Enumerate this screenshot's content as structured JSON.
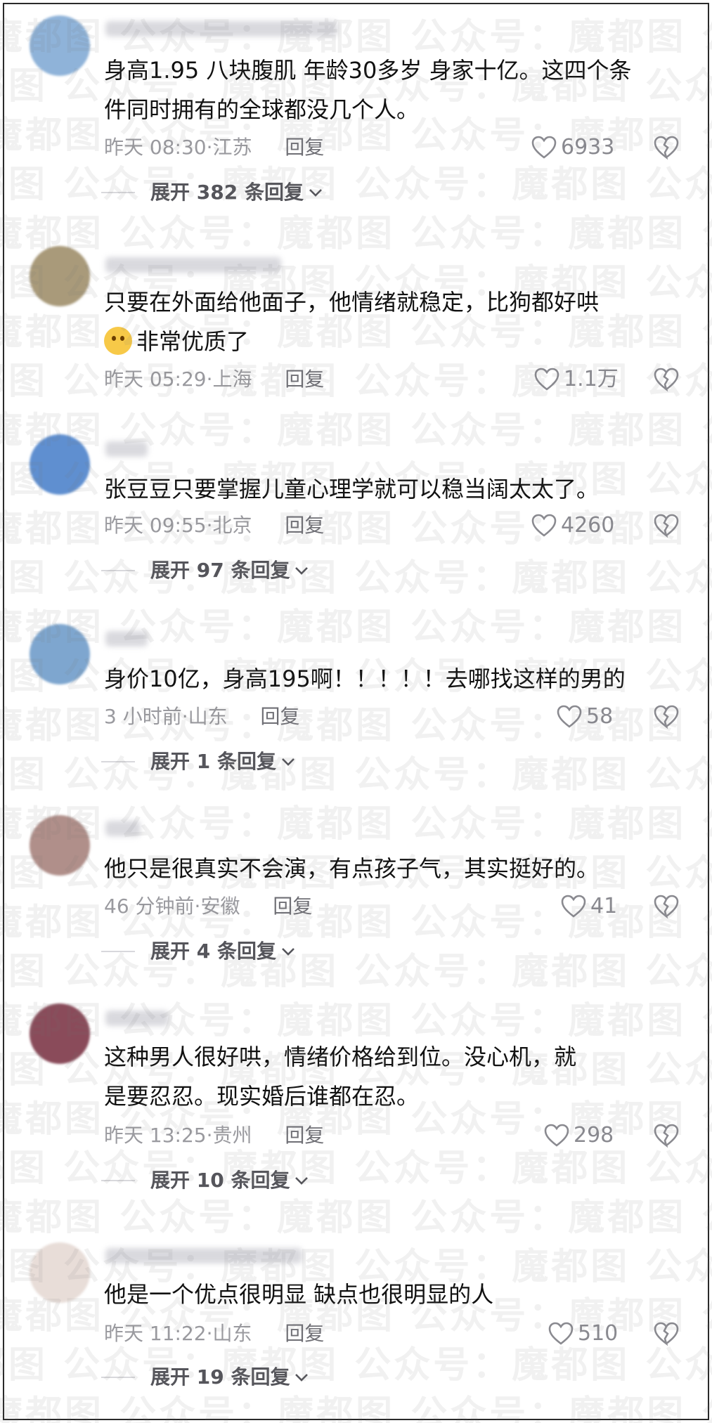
{
  "watermark_text": "魔都图 公众号：魔都图 公众号：魔都图 公众号：魔都图 公众号：",
  "comments": [
    {
      "text_lines": [
        "身高1.95 八块腹肌 年龄30多岁 身家十亿。这四个条",
        "件同时拥有的全球都没几个人。"
      ],
      "time": "昨天 08:30",
      "location": "江苏",
      "reply_label": "回复",
      "likes": "6933",
      "expand_label": "展开 382 条回复",
      "avatar_color": "#8fb3d9"
    },
    {
      "text_lines": [
        "只要在外面给他面子，他情绪就稳定，比狗都好哄",
        "非常优质了"
      ],
      "time": "昨天 05:29",
      "location": "上海",
      "reply_label": "回复",
      "likes": "1.1万",
      "expand_label": "",
      "avatar_color": "#a99a7a"
    },
    {
      "text_lines": [
        "张豆豆只要掌握儿童心理学就可以稳当阔太太了。"
      ],
      "time": "昨天 09:55",
      "location": "北京",
      "reply_label": "回复",
      "likes": "4260",
      "expand_label": "展开 97 条回复",
      "avatar_color": "#5f8fd0"
    },
    {
      "text_lines": [
        "身价10亿，身高195啊！！！！！去哪找这样的男的"
      ],
      "time": "3 小时前",
      "location": "山东",
      "reply_label": "回复",
      "likes": "58",
      "expand_label": "展开 1 条回复",
      "avatar_color": "#7ea6cf"
    },
    {
      "text_lines": [
        "他只是很真实不会演，有点孩子气，其实挺好的。"
      ],
      "time": "46 分钟前",
      "location": "安徽",
      "reply_label": "回复",
      "likes": "41",
      "expand_label": "展开 4 条回复",
      "avatar_color": "#b08f8a"
    },
    {
      "text_lines": [
        "这种男人很好哄，情绪价格给到位。没心机，就",
        "是要忍忍。现实婚后谁都在忍。"
      ],
      "time": "昨天 13:25",
      "location": "贵州",
      "reply_label": "回复",
      "likes": "298",
      "expand_label": "展开 10 条回复",
      "avatar_color": "#8a4b5a"
    },
    {
      "text_lines": [
        "他是一个优点很明显 缺点也很明显的人"
      ],
      "time": "昨天 11:22",
      "location": "山东",
      "reply_label": "回复",
      "likes": "510",
      "expand_label": "展开 19 条回复",
      "avatar_color": "#e8ddd8"
    }
  ]
}
